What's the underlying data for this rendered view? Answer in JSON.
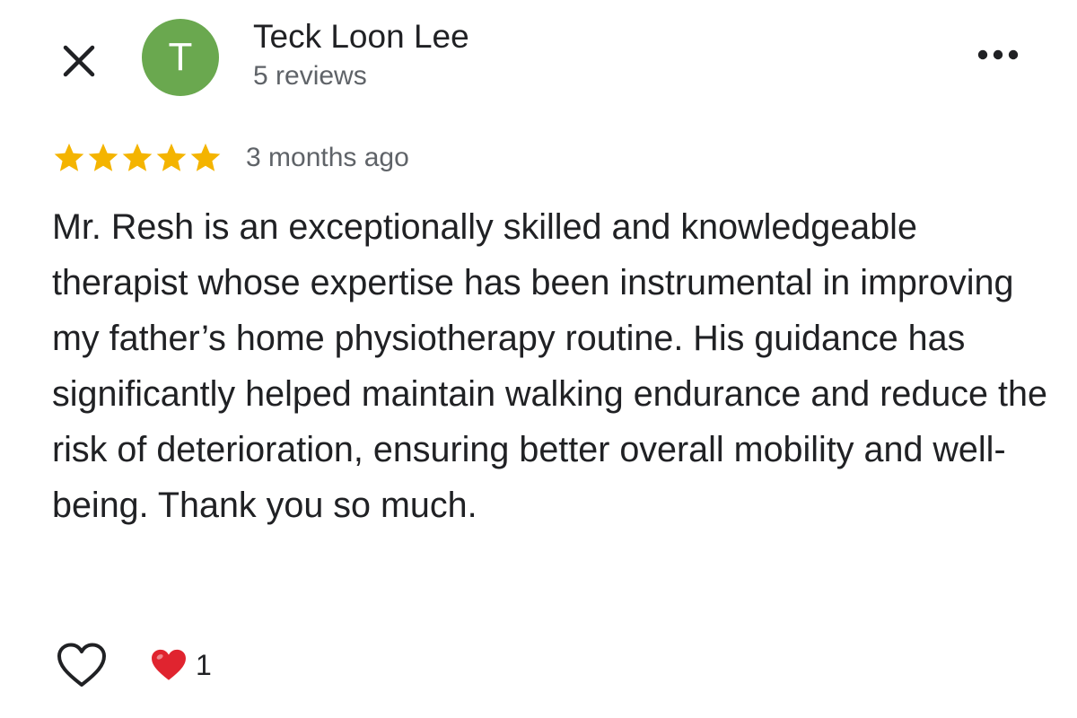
{
  "header": {
    "close_icon": "close-icon",
    "avatar_letter": "T",
    "avatar_color": "#6aa84f",
    "reviewer_name": "Teck Loon Lee",
    "reviewer_meta": "5 reviews",
    "more_icon": "more-horizontal-icon"
  },
  "review": {
    "rating": 5,
    "rating_max": 5,
    "star_color": "#f4b400",
    "time_ago": "3 months ago",
    "text": "Mr. Resh is an exceptionally skilled and knowledgeable therapist whose expertise has been instrumental in improving my father’s home physiotherapy routine. His guidance has significantly helped maintain walking endurance and reduce the risk of deterioration, ensuring better overall mobility and well-being. Thank you so much."
  },
  "actions": {
    "like_icon": "heart-outline-icon",
    "reaction_icon": "red-heart-icon",
    "reaction_color": "#e0242f",
    "reaction_count": "1"
  }
}
